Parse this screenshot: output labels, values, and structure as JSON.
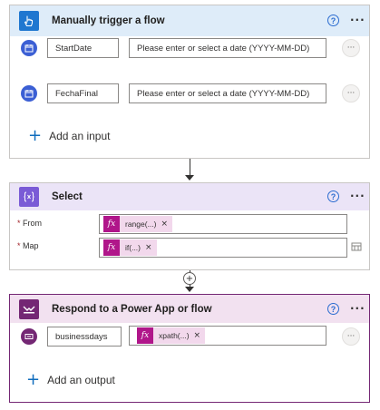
{
  "trigger": {
    "title": "Manually trigger a flow",
    "help_glyph": "?",
    "more_glyph": "···",
    "accent": "#1f77d0",
    "header_bg": "#deecf9",
    "inputs": [
      {
        "name": "StartDate",
        "placeholder": "Please enter or select a date (YYYY-MM-DD)",
        "more_glyph": "···"
      },
      {
        "name": "FechaFinal",
        "placeholder": "Please enter or select a date (YYYY-MM-DD)",
        "more_glyph": "···"
      }
    ],
    "add_label": "Add an input",
    "add_glyph": "+"
  },
  "select": {
    "title": "Select",
    "help_glyph": "?",
    "more_glyph": "···",
    "accent": "#7a5bd6",
    "header_bg": "#ebe4f7",
    "from_label": "From",
    "map_label": "Map",
    "required_mark": "*",
    "from_token": "range(...)",
    "map_token": "if(...)",
    "fx_glyph": "fx",
    "remove_glyph": "×"
  },
  "insert_glyph": "+",
  "respond": {
    "title": "Respond to a Power App or flow",
    "help_glyph": "?",
    "more_glyph": "···",
    "accent": "#742774",
    "header_bg": "#f2e1f0",
    "output_name": "businessdays",
    "output_token": "xpath(...)",
    "row_more_glyph": "···",
    "add_label": "Add an output",
    "add_glyph": "+"
  }
}
